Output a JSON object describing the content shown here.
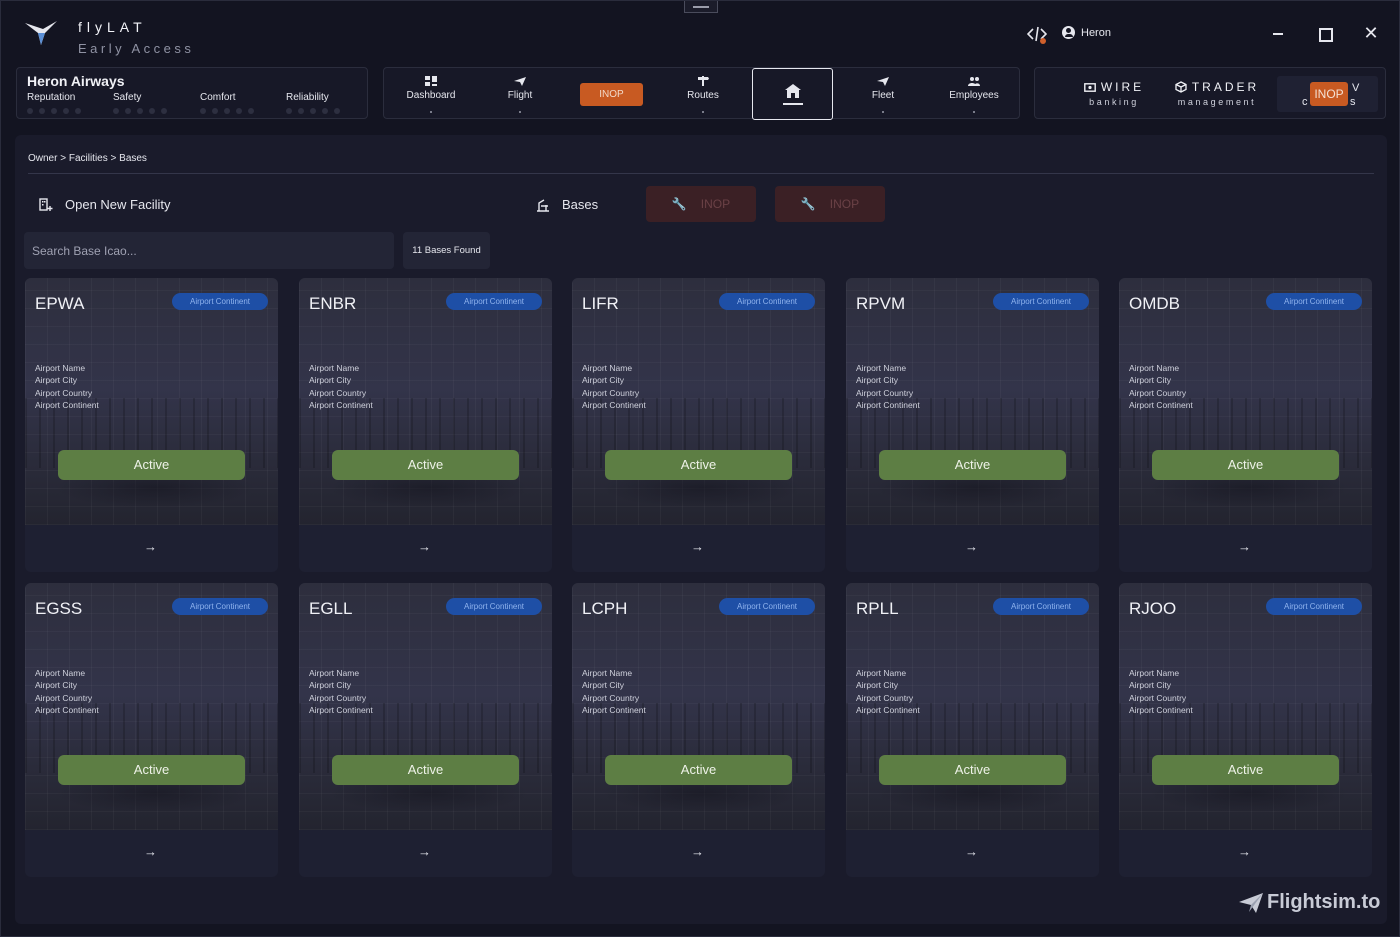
{
  "app": {
    "title": "flyLAT",
    "subtitle": "Early Access",
    "user": "Heron"
  },
  "airline": {
    "name": "Heron Airways",
    "metrics": [
      {
        "label": "Reputation",
        "level": 0
      },
      {
        "label": "Safety",
        "level": 0
      },
      {
        "label": "Comfort",
        "level": 0
      },
      {
        "label": "Reliability",
        "level": 0
      }
    ]
  },
  "nav": {
    "dashboard": "Dashboard",
    "flight": "Flight",
    "inop": "INOP",
    "routes": "Routes",
    "fleet": "Fleet",
    "employees": "Employees"
  },
  "services": {
    "wire_top": "WIRE",
    "wire_bottom": "banking",
    "trader_top": "TRADER",
    "trader_bottom": "management",
    "third_inop": "INOP",
    "third_partial_right_top": "V",
    "third_partial_left_bottom": "c",
    "third_partial_right_bottom": "s"
  },
  "breadcrumb": "Owner > Facilities > Bases",
  "toolbar": {
    "open_new": "Open New Facility",
    "bases": "Bases",
    "inop_1": "INOP",
    "inop_2": "INOP"
  },
  "search": {
    "placeholder": "Search Base Icao..."
  },
  "found_label": "11 Bases Found",
  "card_labels": {
    "badge": "Airport Continent",
    "name": "Airport Name",
    "city": "Airport City",
    "country": "Airport Country",
    "continent": "Airport Continent",
    "status": "Active",
    "arrow": "→"
  },
  "bases": [
    "EPWA",
    "ENBR",
    "LIFR",
    "RPVM",
    "OMDB",
    "EGSS",
    "EGLL",
    "LCPH",
    "RPLL",
    "RJOO"
  ],
  "watermark": "Flightsim.to",
  "colors": {
    "accent_orange": "#c85a22",
    "active_green": "#5d7e44",
    "badge_blue": "#1e4fa6"
  }
}
